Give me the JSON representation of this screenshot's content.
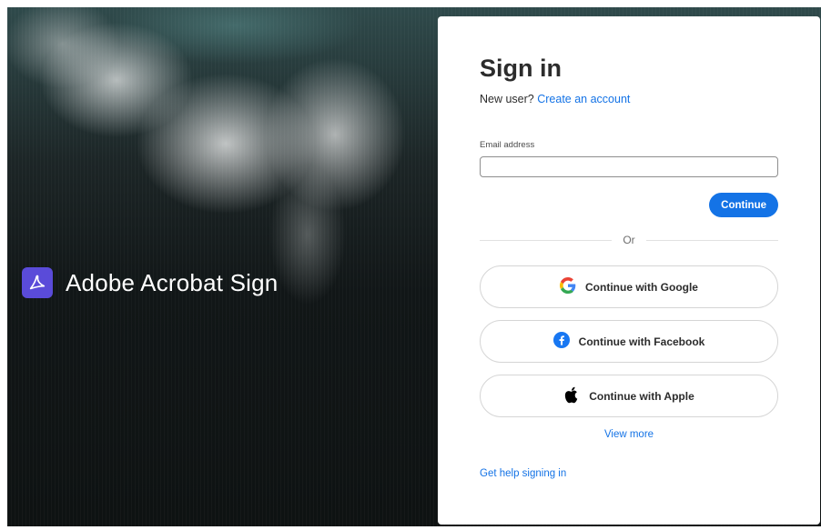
{
  "brand": {
    "name": "Adobe Acrobat Sign",
    "logo_color": "#5a4bd9"
  },
  "signin": {
    "title": "Sign in",
    "new_user_text": "New user?",
    "create_account_link": "Create an account",
    "email_label": "Email address",
    "email_value": "",
    "continue_label": "Continue",
    "divider_text": "Or",
    "google_label": "Continue with Google",
    "facebook_label": "Continue with Facebook",
    "apple_label": "Continue with Apple",
    "view_more_link": "View more",
    "help_link": "Get help signing in"
  },
  "colors": {
    "accent": "#1473e6",
    "text": "#2c2c2c"
  },
  "icons": [
    "acrobat-logo-icon",
    "google-icon",
    "facebook-icon",
    "apple-icon"
  ]
}
